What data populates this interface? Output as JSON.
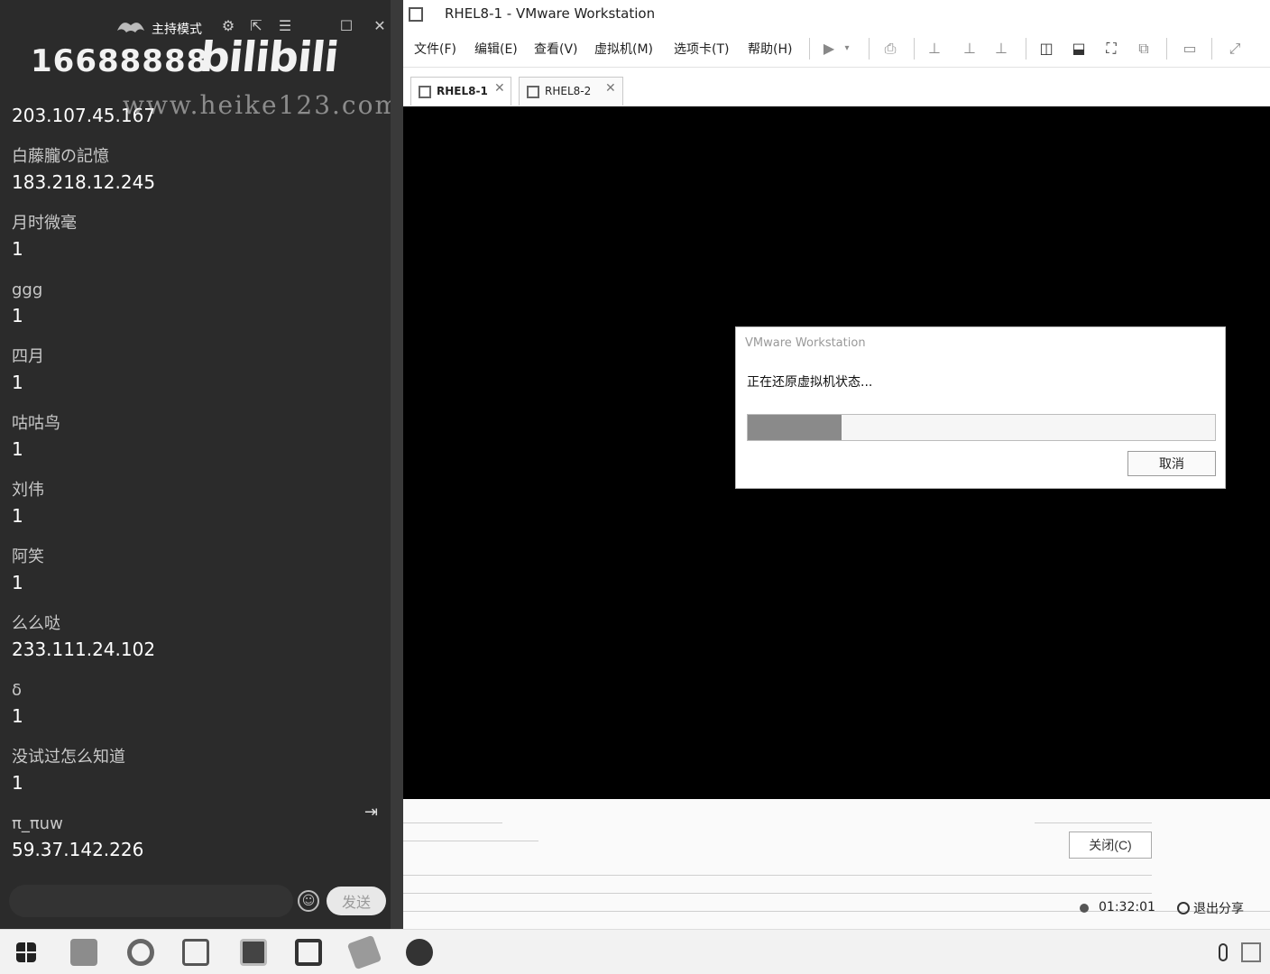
{
  "chat": {
    "host_mode": "主持模式",
    "room_number": "16688888",
    "brand": "bilibili",
    "watermark": "www.heike123.com",
    "messages": [
      {
        "name": "",
        "text": "203.107.45.167"
      },
      {
        "name": "白藤朧の記憶",
        "text": "183.218.12.245"
      },
      {
        "name": "月时微毫",
        "text": "1"
      },
      {
        "name": "ggg",
        "text": "1"
      },
      {
        "name": "四月",
        "text": "1"
      },
      {
        "name": "咕咕鸟",
        "text": "1"
      },
      {
        "name": "刘伟",
        "text": "1"
      },
      {
        "name": "阿笑",
        "text": "1"
      },
      {
        "name": "么么哒",
        "text": "233.111.24.102"
      },
      {
        "name": "δ",
        "text": "1"
      },
      {
        "name": "没试过怎么知道",
        "text": "1"
      },
      {
        "name": "π_πuw",
        "text": "59.37.142.226"
      }
    ],
    "input_placeholder": "",
    "send_label": "发送"
  },
  "vmware": {
    "title": "RHEL8-1 - VMware Workstation",
    "menu": [
      "文件(F)",
      "编辑(E)",
      "查看(V)",
      "虚拟机(M)",
      "选项卡(T)",
      "帮助(H)"
    ],
    "tabs": [
      {
        "label": "RHEL8-1",
        "active": true
      },
      {
        "label": "RHEL8-2",
        "active": false
      }
    ],
    "dialog": {
      "title": "VMware Workstation",
      "message": "正在还原虚拟机状态...",
      "progress_percent": 20,
      "cancel_label": "取消"
    },
    "status": {
      "close_label": "关闭(C)",
      "timer": "01:32:01",
      "exit_share_label": "退出分享"
    }
  },
  "colors": {
    "chat_bg": "#2b2b2b",
    "vm_screen": "#000000",
    "progress_fill": "#8a8a8a"
  }
}
